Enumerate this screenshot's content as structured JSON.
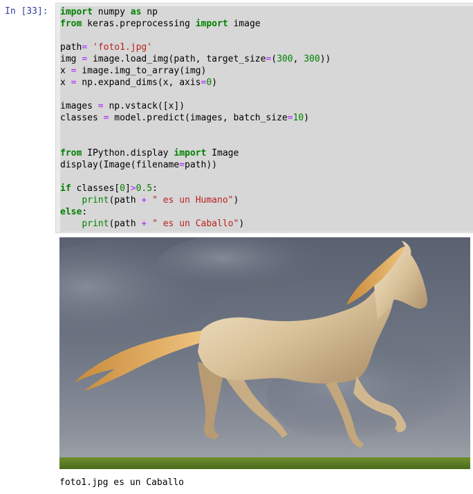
{
  "cell": {
    "prompt": "In [33]:",
    "code_lines": [
      [
        [
          "kw",
          "import"
        ],
        [
          "t",
          " numpy "
        ],
        [
          "kw",
          "as"
        ],
        [
          "t",
          " np"
        ]
      ],
      [
        [
          "kw",
          "from"
        ],
        [
          "t",
          " keras.preprocessing "
        ],
        [
          "kw",
          "import"
        ],
        [
          "t",
          " image"
        ]
      ],
      [],
      [
        [
          "t",
          "path"
        ],
        [
          "op",
          "="
        ],
        [
          "t",
          " "
        ],
        [
          "str",
          "'foto1.jpg'"
        ]
      ],
      [
        [
          "t",
          "img "
        ],
        [
          "op",
          "="
        ],
        [
          "t",
          " image.load_img(path, target_size"
        ],
        [
          "op",
          "="
        ],
        [
          "t",
          "("
        ],
        [
          "num",
          "300"
        ],
        [
          "t",
          ", "
        ],
        [
          "num",
          "300"
        ],
        [
          "t",
          "))"
        ]
      ],
      [
        [
          "t",
          "x "
        ],
        [
          "op",
          "="
        ],
        [
          "t",
          " image.img_to_array(img)"
        ]
      ],
      [
        [
          "t",
          "x "
        ],
        [
          "op",
          "="
        ],
        [
          "t",
          " np.expand_dims(x, axis"
        ],
        [
          "op",
          "="
        ],
        [
          "num",
          "0"
        ],
        [
          "t",
          ")"
        ]
      ],
      [],
      [
        [
          "t",
          "images "
        ],
        [
          "op",
          "="
        ],
        [
          "t",
          " np.vstack([x])"
        ]
      ],
      [
        [
          "t",
          "classes "
        ],
        [
          "op",
          "="
        ],
        [
          "t",
          " model.predict(images, batch_size"
        ],
        [
          "op",
          "="
        ],
        [
          "num",
          "10"
        ],
        [
          "t",
          ")"
        ]
      ],
      [],
      [],
      [
        [
          "kw",
          "from"
        ],
        [
          "t",
          " IPython.display "
        ],
        [
          "kw",
          "import"
        ],
        [
          "t",
          " Image"
        ]
      ],
      [
        [
          "t",
          "display(Image(filename"
        ],
        [
          "op",
          "="
        ],
        [
          "t",
          "path))"
        ]
      ],
      [],
      [
        [
          "kw",
          "if"
        ],
        [
          "t",
          " classes["
        ],
        [
          "num",
          "0"
        ],
        [
          "t",
          "]"
        ],
        [
          "op",
          ">"
        ],
        [
          "num",
          "0.5"
        ],
        [
          "t",
          ":"
        ]
      ],
      [
        [
          "t",
          "    "
        ],
        [
          "bi",
          "print"
        ],
        [
          "t",
          "(path "
        ],
        [
          "op",
          "+"
        ],
        [
          "t",
          " "
        ],
        [
          "str",
          "\" es un Humano\""
        ],
        [
          "t",
          ")"
        ]
      ],
      [
        [
          "kw",
          "else"
        ],
        [
          "t",
          ":"
        ]
      ],
      [
        [
          "t",
          "    "
        ],
        [
          "bi",
          "print"
        ],
        [
          "t",
          "(path "
        ],
        [
          "op",
          "+"
        ],
        [
          "t",
          " "
        ],
        [
          "str",
          "\" es un Caballo\""
        ],
        [
          "t",
          ")"
        ]
      ]
    ],
    "output_text": "foto1.jpg es un Caballo"
  },
  "colors": {
    "prompt": "#303f9f",
    "keyword": "#008000",
    "string": "#ba2121",
    "operator": "#aa22ff",
    "selection": "#d7d7d7"
  },
  "image": {
    "subject": "galloping palomino horse under stormy sky",
    "alt": "horse-photo"
  }
}
